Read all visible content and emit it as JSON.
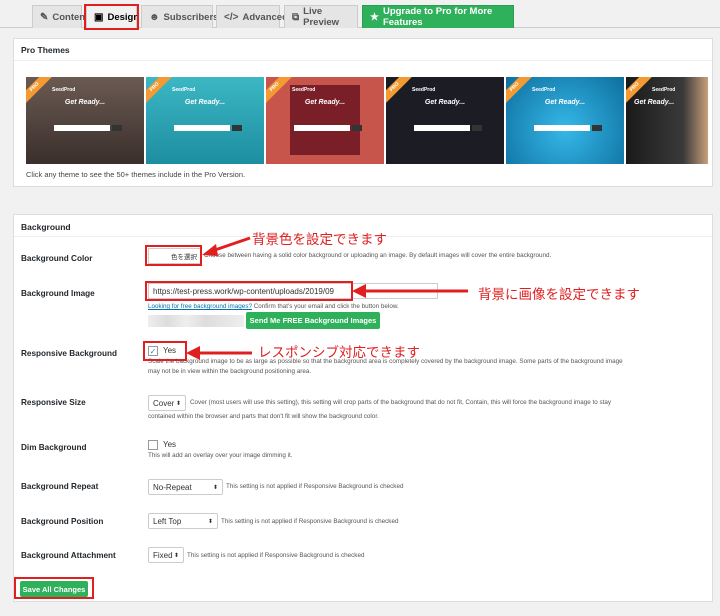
{
  "tabs": [
    {
      "label": "Content",
      "icon": "edit-icon"
    },
    {
      "label": "Design",
      "icon": "image-icon"
    },
    {
      "label": "Subscribers",
      "icon": "users-icon"
    },
    {
      "label": "Advanced",
      "icon": "code-icon"
    },
    {
      "label": "Live Preview",
      "icon": "external-link-icon"
    },
    {
      "label": "Upgrade to Pro for More Features",
      "icon": "star-icon"
    }
  ],
  "pro_themes": {
    "title": "Pro Themes",
    "note": "Click any theme to see the 50+ themes include in the Pro Version.",
    "thumb_ribbon": "PRO",
    "thumb_brand": "SeedProd",
    "thumb_heading": "Get Ready...",
    "thumb_colors": [
      "#5a4a45",
      "#2b9fb0",
      "#c8554b",
      "#1c1c24",
      "#1b8fbf",
      "#2a2a2a"
    ]
  },
  "background": {
    "title": "Background",
    "color": {
      "label": "Background Color",
      "button": "色を選択",
      "help": "Choose between having a solid color background or uploading an image. By default images will cover the entire background."
    },
    "image": {
      "label": "Background Image",
      "value": "https://test-press.work/wp-content/uploads/2019/09",
      "link_text": "Looking for free background images?",
      "link_after": " Confirm that's your email and click the button below.",
      "button": "Send Me FREE Background Images"
    },
    "responsive": {
      "label": "Responsive Background",
      "checkbox_label": "Yes",
      "help1": "Scale the background image to be as large as possible so that the background area is completely covered by the background image. Some parts of the background image",
      "help2": "may not be in view within the background positioning area."
    },
    "size": {
      "label": "Responsive Size",
      "value": "Cover",
      "help1": "Cover (most users will use this setting), this setting will crop parts of the background that do not fit, Contain, this will force the background image to stay",
      "help2": "contained within the browser and parts that don't fit will show the background color."
    },
    "dim": {
      "label": "Dim Background",
      "checkbox_label": "Yes",
      "help": "This will add an overlay over your image dimming it."
    },
    "repeat": {
      "label": "Background Repeat",
      "value": "No-Repeat",
      "help": "This setting is not applied if Responsive Background is checked"
    },
    "position": {
      "label": "Background Position",
      "value": "Left Top",
      "help": "This setting is not applied if Responsive Background is checked"
    },
    "attachment": {
      "label": "Background Attachment",
      "value": "Fixed",
      "help": "This setting is not applied if Responsive Background is checked"
    },
    "save_button": "Save All Changes"
  },
  "annotations": {
    "color": "背景色を設定できます",
    "image": "背景に画像を設定できます",
    "responsive": "レスポンシブ対応できます"
  },
  "colors": {
    "accent_green": "#2fb15b",
    "annotation_red": "#e02020",
    "link_blue": "#0073aa"
  }
}
